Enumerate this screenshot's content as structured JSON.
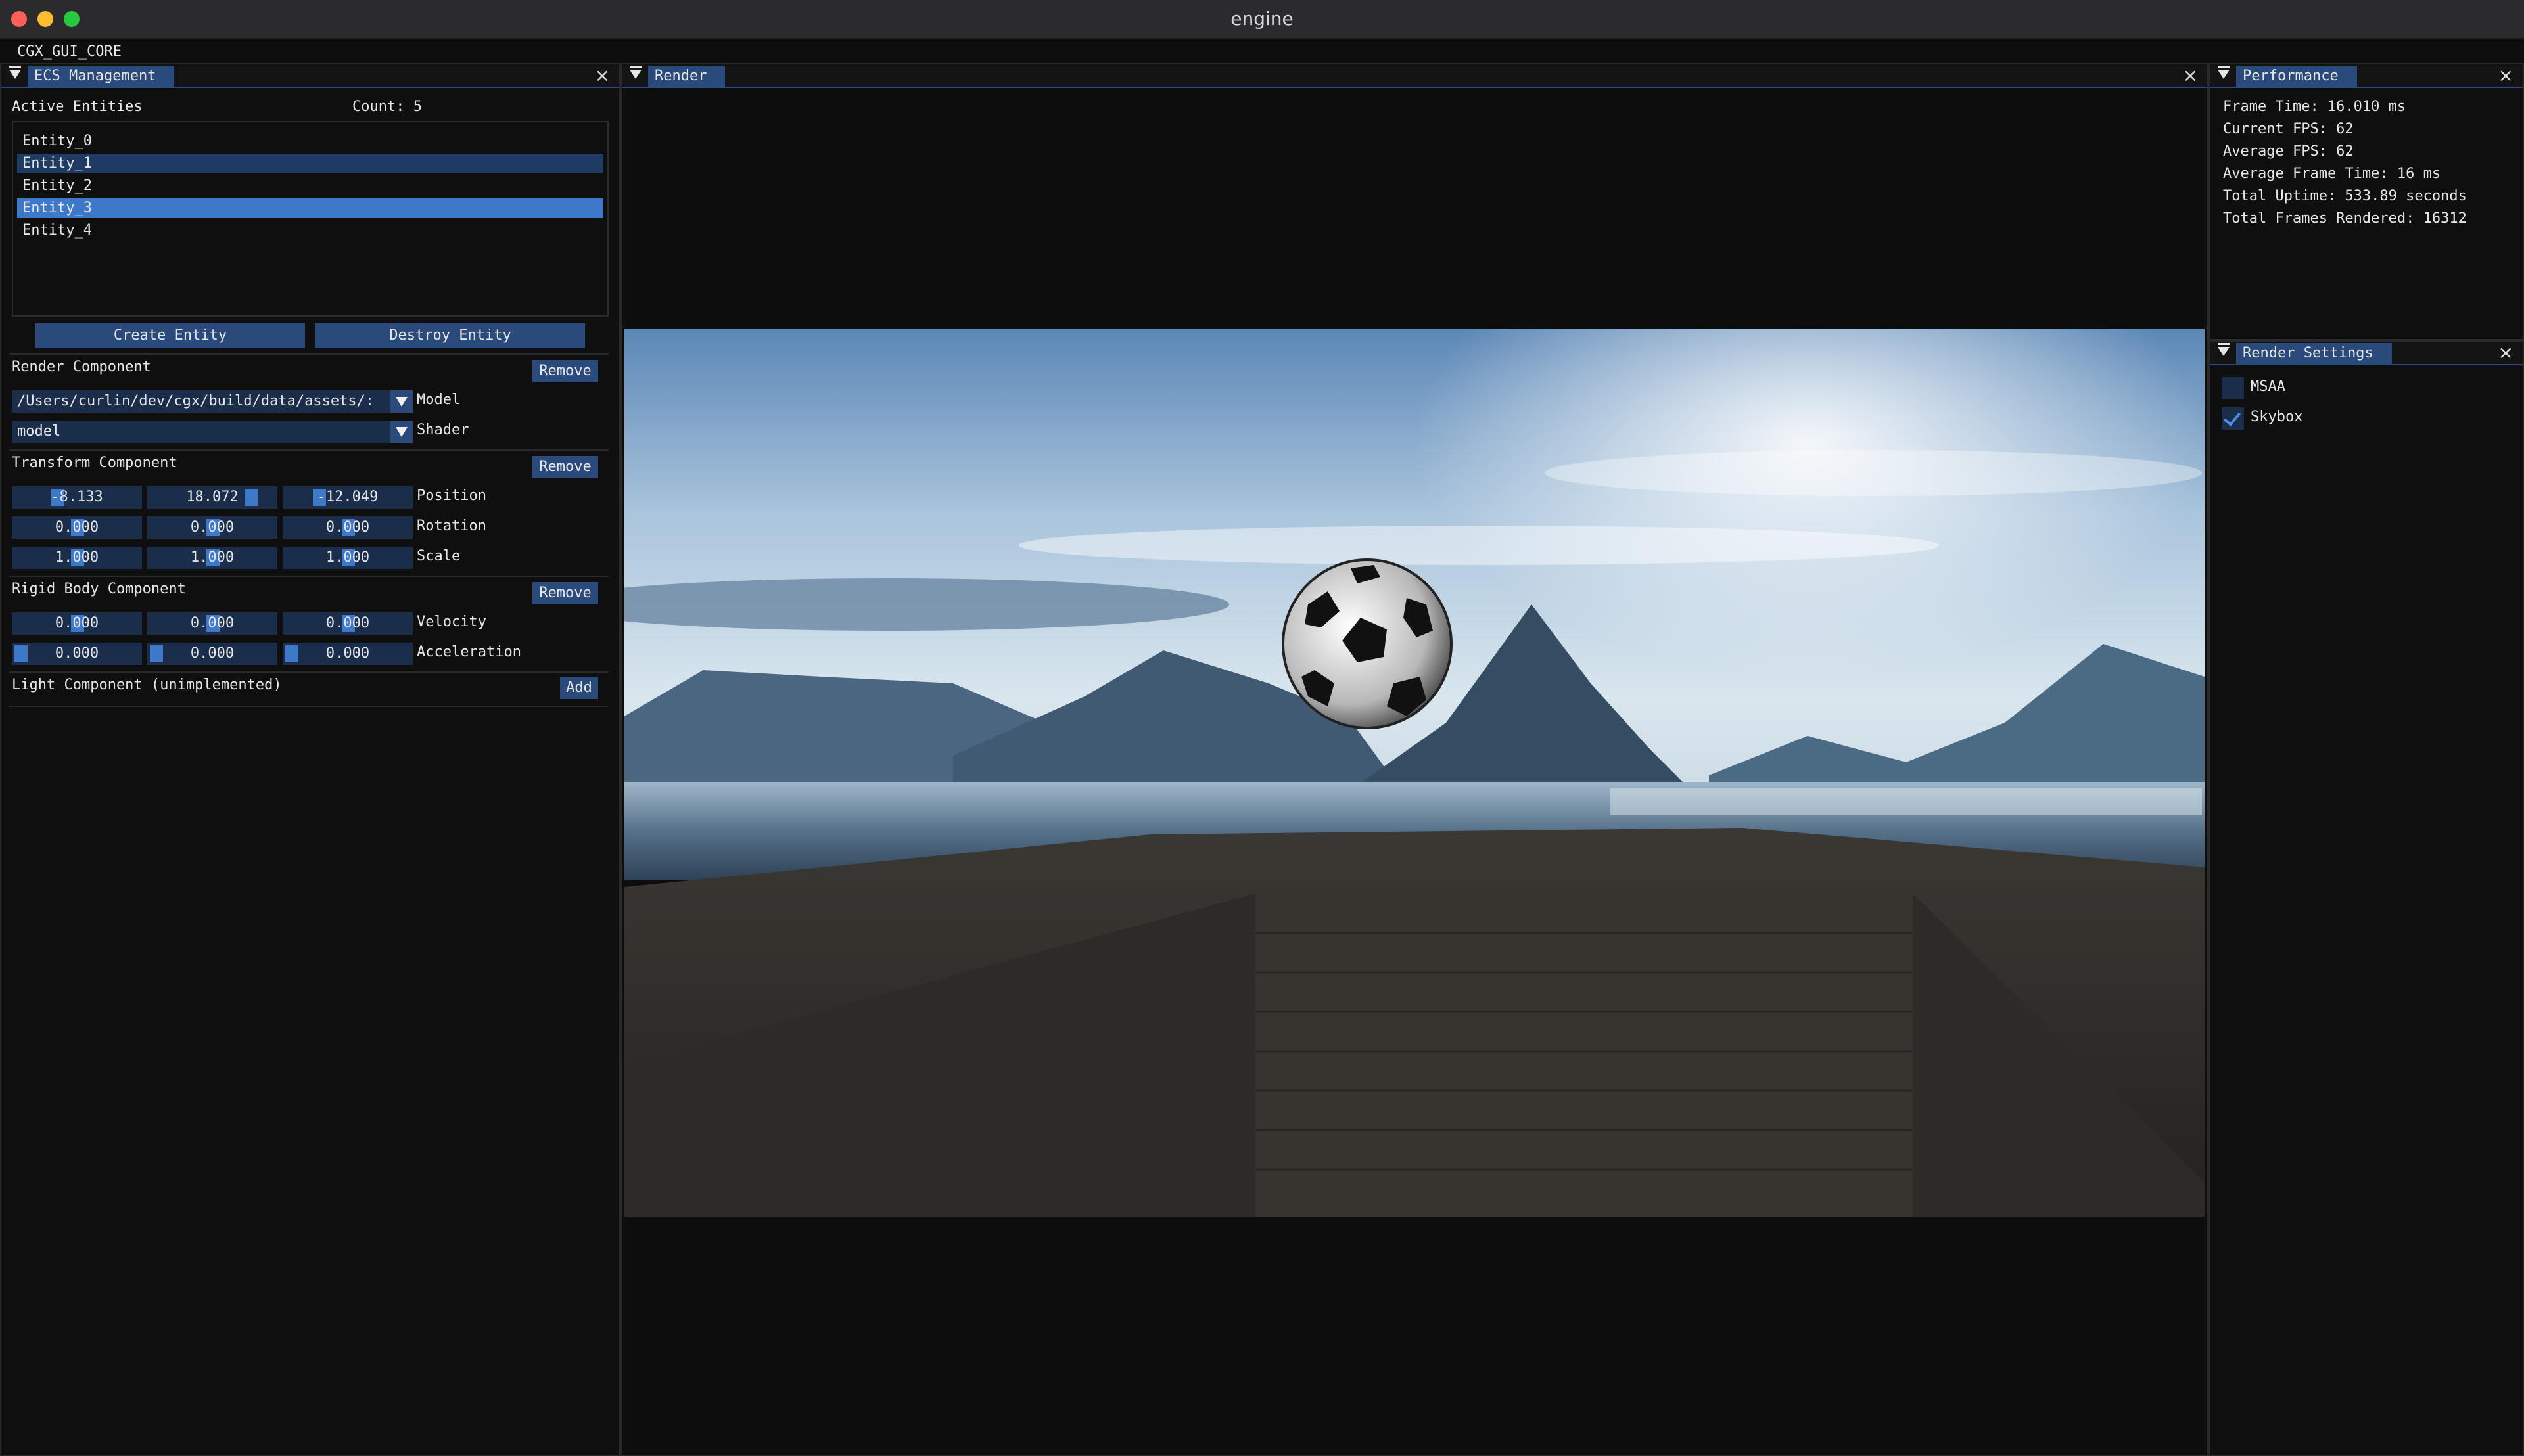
{
  "window": {
    "title": "engine"
  },
  "menubar": {
    "label": "CGX_GUI_CORE"
  },
  "ecs": {
    "tab": "ECS Management",
    "active_entities_label": "Active Entities",
    "count_label": "Count: 5",
    "entities": [
      "Entity_0",
      "Entity_1",
      "Entity_2",
      "Entity_3",
      "Entity_4"
    ],
    "create_button": "Create Entity",
    "destroy_button": "Destroy Entity",
    "render_component": {
      "title": "Render Component",
      "remove": "Remove",
      "model_value": "/Users/curlin/dev/cgx/build/data/assets/:",
      "model_label": "Model",
      "shader_value": "model",
      "shader_label": "Shader"
    },
    "transform_component": {
      "title": "Transform Component",
      "remove": "Remove",
      "position": [
        "-8.133",
        "18.072",
        "-12.049"
      ],
      "position_label": "Position",
      "rotation": [
        "0.000",
        "0.000",
        "0.000"
      ],
      "rotation_label": "Rotation",
      "scale": [
        "1.000",
        "1.000",
        "1.000"
      ],
      "scale_label": "Scale"
    },
    "rigid_body_component": {
      "title": "Rigid Body Component",
      "remove": "Remove",
      "velocity": [
        "0.000",
        "0.000",
        "0.000"
      ],
      "velocity_label": "Velocity",
      "acceleration": [
        "0.000",
        "0.000",
        "0.000"
      ],
      "acceleration_label": "Acceleration"
    },
    "light_component": {
      "title": "Light Component (unimplemented)",
      "add": "Add"
    }
  },
  "render": {
    "tab": "Render"
  },
  "performance": {
    "tab": "Performance",
    "lines": [
      "Frame Time: 16.010 ms",
      "Current FPS: 62",
      "Average FPS: 62",
      "Average Frame Time: 16 ms",
      "Total Uptime: 533.89 seconds",
      "Total Frames Rendered: 16312"
    ]
  },
  "render_settings": {
    "tab": "Render Settings",
    "msaa_label": "MSAA",
    "msaa_checked": false,
    "skybox_label": "Skybox",
    "skybox_checked": true
  },
  "colors": {
    "accent": "#3d78c9",
    "tab": "#294a7a",
    "field": "#1a2d4a",
    "background": "#0f0f0f"
  }
}
